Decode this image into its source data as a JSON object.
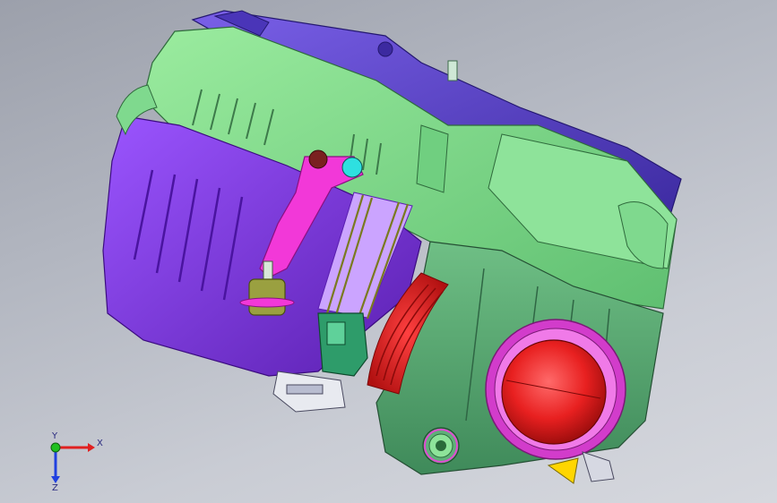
{
  "viewport": {
    "background_top": "#9ca0ab",
    "background_bottom": "#d6d8de"
  },
  "model": {
    "colors": {
      "housing_green": "#7fd98e",
      "housing_green_dark": "#5fbf71",
      "lid_violet": "#7a2fe0",
      "lid_violet_dark": "#5a1fb0",
      "top_cover_indigo": "#5b40c8",
      "lower_body_green": "#5fb079",
      "bracket_magenta": "#f238d8",
      "pipe_red": "#e82020",
      "flange_magenta": "#e04ad2",
      "sensor_teal": "#2e9c6a",
      "bushing_olive": "#9aa040",
      "clip_yellow": "#ffd600"
    }
  },
  "triad": {
    "x_label": "X",
    "y_label": "Y",
    "z_label": "Z",
    "x_color": "#e02020",
    "y_color": "#20c020",
    "z_color": "#2040e0"
  }
}
